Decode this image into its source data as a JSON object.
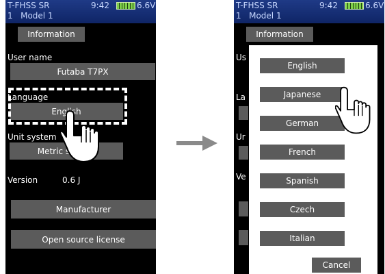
{
  "status": {
    "system": "T-FHSS SR",
    "model_prefix": "1",
    "model": "Model 1",
    "time": "9:42",
    "voltage": "6.6V"
  },
  "left": {
    "tab": "Information",
    "user_name_label": "User name",
    "user_name_value": "Futaba T7PX",
    "language_label": "Language",
    "language_value": "English",
    "unit_system_label": "Unit system",
    "unit_system_value": "Metric system",
    "version_label": "Version",
    "version_value": "0.6 J",
    "manufacturer_button": "Manufacturer",
    "license_button": "Open source license"
  },
  "right": {
    "tab": "Information",
    "bg_fragments": [
      "Us",
      "La",
      "Ur",
      "Ve"
    ],
    "languages": [
      "English",
      "Japanese",
      "German",
      "French",
      "Spanish",
      "Czech",
      "Italian"
    ],
    "cancel": "Cancel"
  },
  "colors": {
    "screen_bg": "#000000",
    "status_bar": "#1f3a86",
    "button": "#5b5b5b",
    "highlight_dash": "#ffffff",
    "arrow": "#8a8a8a"
  },
  "icons": {
    "pointer": "hand-pointer-icon",
    "battery": "battery-icon",
    "arrow": "right-arrow-icon"
  }
}
